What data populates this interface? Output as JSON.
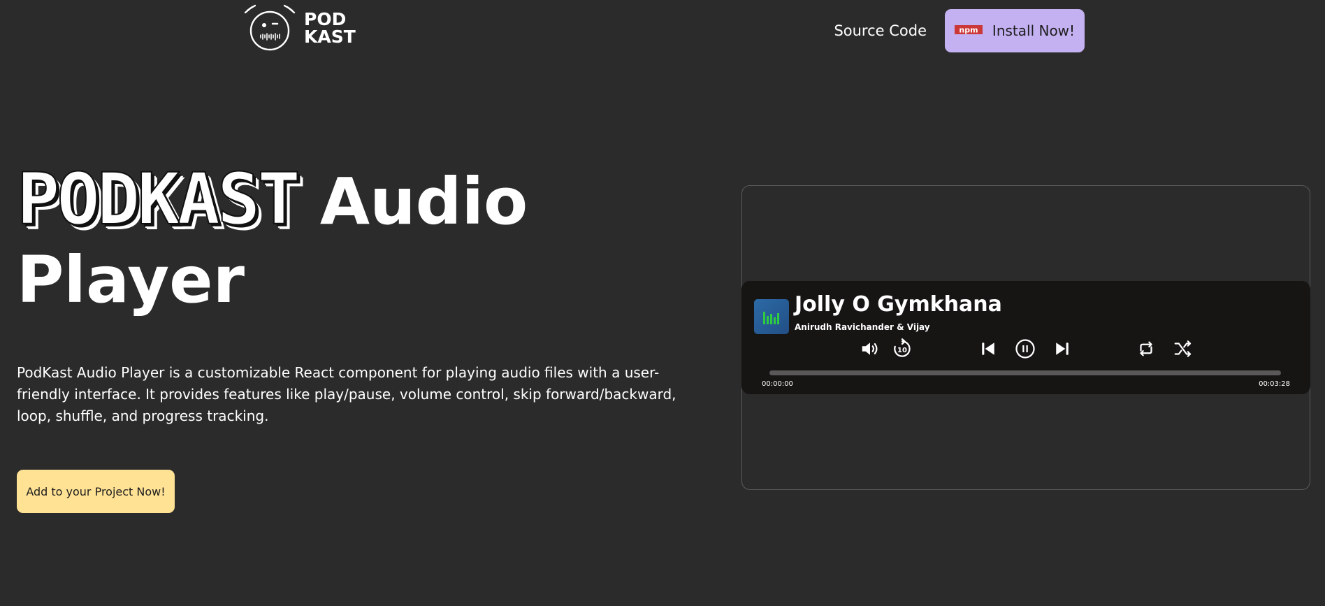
{
  "header": {
    "logo_line1": "POD",
    "logo_line2": "KAST",
    "nav_source_label": "Source Code",
    "install_label": "Install Now!"
  },
  "hero": {
    "title_outline": "PODKAST",
    "title_word1": "Audio",
    "title_word2": "Player",
    "description": "PodKast Audio Player is a customizable React component for playing audio files with a user-friendly interface. It provides features like play/pause, volume control, skip forward/backward, loop, shuffle, and progress tracking.",
    "cta_label": "Add to your Project Now!"
  },
  "player": {
    "track_title": "Jolly O Gymkhana",
    "artist": "Anirudh Ravichander & Vijay",
    "current_time": "00:00:00",
    "duration": "00:03:28",
    "progress_percent": 0,
    "controls": [
      "volume-icon",
      "skip-10-icon",
      "previous-icon",
      "pause-icon",
      "next-icon",
      "loop-icon",
      "shuffle-icon"
    ]
  },
  "colors": {
    "background": "#2b2b2b",
    "install_button": "#c4b1f2",
    "cta_button": "#ffe294",
    "player_background": "#171414",
    "cover_icon": "#2ecc40"
  }
}
